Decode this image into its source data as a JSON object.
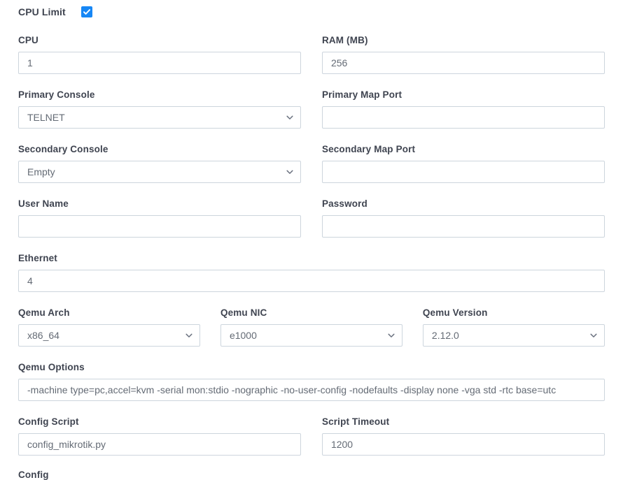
{
  "form": {
    "cpu_limit": {
      "label": "CPU Limit",
      "checked": true,
      "accent_color": "#1787f5"
    },
    "rows": {
      "cpu": {
        "label": "CPU",
        "value": "1"
      },
      "ram": {
        "label": "RAM (MB)",
        "value": "256"
      },
      "primary_console": {
        "label": "Primary Console",
        "value": "TELNET"
      },
      "primary_map_port": {
        "label": "Primary Map Port",
        "value": ""
      },
      "secondary_console": {
        "label": "Secondary Console",
        "value": "Empty"
      },
      "secondary_map_port": {
        "label": "Secondary Map Port",
        "value": ""
      },
      "user_name": {
        "label": "User Name",
        "value": ""
      },
      "password": {
        "label": "Password",
        "value": ""
      },
      "ethernet": {
        "label": "Ethernet",
        "value": "4"
      },
      "qemu_arch": {
        "label": "Qemu Arch",
        "value": "x86_64"
      },
      "qemu_nic": {
        "label": "Qemu NIC",
        "value": "e1000"
      },
      "qemu_version": {
        "label": "Qemu Version",
        "value": "2.12.0"
      },
      "qemu_options": {
        "label": "Qemu Options",
        "value": "-machine type=pc,accel=kvm -serial mon:stdio -nographic -no-user-config -nodefaults -display none -vga std -rtc base=utc"
      },
      "config_script": {
        "label": "Config Script",
        "value": "config_mikrotik.py"
      },
      "script_timeout": {
        "label": "Script Timeout",
        "value": "1200"
      },
      "config": {
        "label": "Config"
      }
    },
    "icons": {
      "checkmark": "check-icon",
      "dropdown": "chevron-down-icon"
    }
  }
}
